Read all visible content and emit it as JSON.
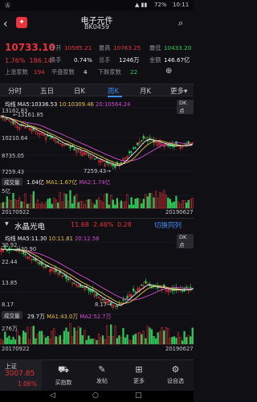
{
  "status_bar": {
    "left": "Ⓐ",
    "battery": "72%",
    "time": "10:11"
  },
  "header": {
    "title": "电子元件",
    "code": "BK0459"
  },
  "quote": {
    "price": "10733.10",
    "change_pct": "1.76%",
    "change": "186.14",
    "fields": [
      {
        "label": "今开",
        "value": "10585.21",
        "color": "red"
      },
      {
        "label": "最高",
        "value": "10763.25",
        "color": "red"
      },
      {
        "label": "最低",
        "value": "10433.20",
        "color": "green"
      },
      {
        "label": "换手",
        "value": "0.74%",
        "color": "white"
      },
      {
        "label": "总手",
        "value": "1246万",
        "color": "white"
      },
      {
        "label": "金额",
        "value": "146.67亿",
        "color": "white"
      }
    ],
    "updown": [
      {
        "label": "上涨家数",
        "value": "194",
        "color": "red"
      },
      {
        "label": "平盘家数",
        "value": "4",
        "color": "white"
      },
      {
        "label": "下跌家数",
        "value": "22",
        "color": "green"
      }
    ]
  },
  "tabs": [
    "分时",
    "五日",
    "日K",
    "周K",
    "月K",
    "更多"
  ],
  "active_tab": "周K",
  "chart1": {
    "ma_legend": {
      "name": "均线",
      "ma5": "MA5:10336.53",
      "ma10": "10:10309.46",
      "ma20": "20:10564.24"
    },
    "dk": "DK点",
    "y_axis": [
      "13162.83",
      "10210.64",
      "8735.05",
      "7259.43"
    ],
    "high_label": "13161.85",
    "low_label": "7259.43",
    "vol_pill": "成交量",
    "vol_legend": {
      "vol": "1.04亿",
      "ma1": "MA1:1.67亿",
      "ma2": "MA2:1.74亿"
    },
    "vol_axis": "5亿",
    "date_start": "20170922",
    "date_end": "20190627"
  },
  "chart2": {
    "name": "水晶光电",
    "price": "11.68",
    "pct": "2.46%",
    "chg": "0.28",
    "switch": "切换同列",
    "ma_legend": {
      "name": "均线",
      "ma5": "MA5:11.30",
      "ma10": "10:11.81",
      "ma20": "20:12.58"
    },
    "dk": "DK点",
    "y_axis": [
      "30.92",
      "22.44",
      "13.85",
      "8.17"
    ],
    "high_label": "30.90",
    "low_label": "8.17",
    "vol_pill": "成交量",
    "vol_legend": {
      "vol": "29.7万",
      "ma1": "MA1:43.0万",
      "ma2": "MA2:52.7万"
    },
    "vol_axis": "276万",
    "date_start": "20170922",
    "date_end": "20190627"
  },
  "bottom": {
    "index_name": "上证",
    "index_value": "3007.85",
    "index_pct": "1.06%",
    "items": [
      {
        "label": "买指数",
        "icon": "cart-icon"
      },
      {
        "label": "发帖",
        "icon": "pen-icon"
      },
      {
        "label": "更多",
        "icon": "grid-icon"
      },
      {
        "label": "设自选",
        "icon": "gear-icon"
      }
    ]
  },
  "colors": {
    "up": "#e8323c",
    "down": "#2fc85a",
    "ma5": "#f2f2f2",
    "ma10": "#e6c24a",
    "ma20": "#d24cd2",
    "accent": "#3b8df0"
  }
}
